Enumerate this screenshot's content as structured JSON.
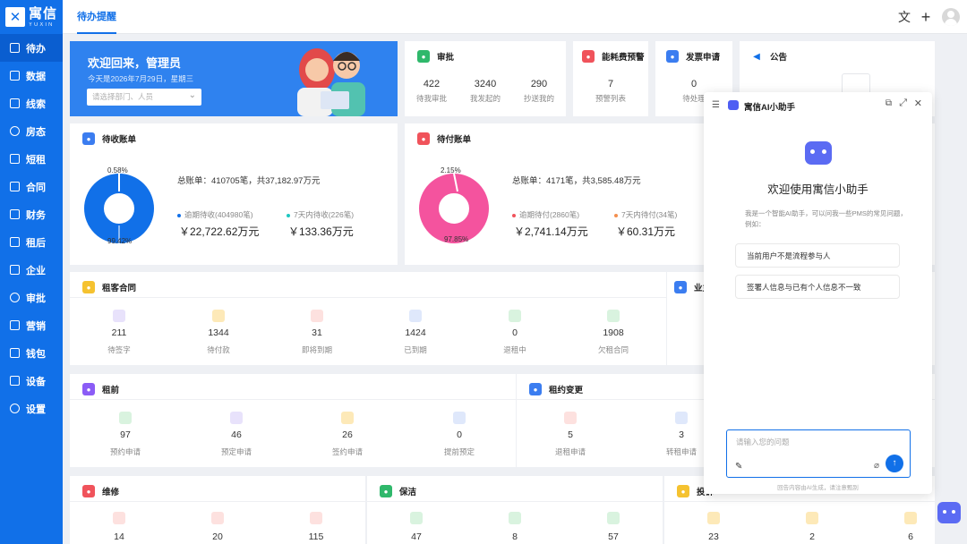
{
  "brand": {
    "logo_cn": "寓信",
    "logo_en": "YUXIN"
  },
  "sidebar": {
    "items": [
      {
        "label": "待办",
        "active": true
      },
      {
        "label": "数据"
      },
      {
        "label": "线索"
      },
      {
        "label": "房态"
      },
      {
        "label": "短租"
      },
      {
        "label": "合同"
      },
      {
        "label": "财务"
      },
      {
        "label": "租后"
      },
      {
        "label": "企业"
      },
      {
        "label": "审批"
      },
      {
        "label": "营销"
      },
      {
        "label": "钱包"
      },
      {
        "label": "设备"
      },
      {
        "label": "设置"
      }
    ]
  },
  "topbar": {
    "tab": "待办提醒"
  },
  "welcome": {
    "title": "欢迎回来，管理员",
    "date": "今天是2026年7月29日，星期三",
    "select_placeholder": "请选择部门、人员"
  },
  "approval": {
    "title": "审批",
    "stats": [
      {
        "value": "422",
        "label": "待我审批"
      },
      {
        "value": "3240",
        "label": "我发起的"
      },
      {
        "value": "290",
        "label": "抄送我的"
      }
    ]
  },
  "energy": {
    "title": "能耗费预警",
    "value": "7",
    "label": "预警列表"
  },
  "invoice": {
    "title": "发票申请",
    "value": "0",
    "label": "待处理"
  },
  "notice": {
    "title": "公告"
  },
  "receivable": {
    "title": "待收账单",
    "total": "总账单：410705笔，共37,182.97万元",
    "overdue_label": "逾期待收(404980笔)",
    "overdue_value": "￥22,722.62万元",
    "week_label": "7天内待收(226笔)",
    "week_value": "￥133.36万元",
    "pct_small": "0.58%",
    "pct_big": "99.42%"
  },
  "payable": {
    "title": "待付账单",
    "total": "总账单：4171笔，共3,585.48万元",
    "overdue_label": "逾期待付(2860笔)",
    "overdue_value": "￥2,741.14万元",
    "week_label": "7天内待付(34笔)",
    "week_value": "￥60.31万元",
    "pct_small": "2.15%",
    "pct_big": "97.85%"
  },
  "right_axis": "500",
  "tenant_contract": {
    "title": "租客合同",
    "items": [
      {
        "value": "211",
        "label": "待签字"
      },
      {
        "value": "1344",
        "label": "待付款"
      },
      {
        "value": "31",
        "label": "即将到期"
      },
      {
        "value": "1424",
        "label": "已到期"
      },
      {
        "value": "0",
        "label": "退租中"
      },
      {
        "value": "1908",
        "label": "欠租合同"
      }
    ]
  },
  "owner_partial": "业主",
  "pre_rent": {
    "title": "租前",
    "items": [
      {
        "value": "97",
        "label": "预约申请"
      },
      {
        "value": "46",
        "label": "预定申请"
      },
      {
        "value": "26",
        "label": "签约申请"
      },
      {
        "value": "0",
        "label": "提前预定"
      }
    ]
  },
  "lease_change": {
    "title": "租约变更",
    "items": [
      {
        "value": "5",
        "label": "退租申请"
      },
      {
        "value": "3",
        "label": "转租申请"
      }
    ]
  },
  "repair": {
    "title": "维修",
    "items": [
      {
        "value": "14"
      },
      {
        "value": "20"
      },
      {
        "value": "115"
      }
    ]
  },
  "cleaning": {
    "title": "保洁",
    "items": [
      {
        "value": "47"
      },
      {
        "value": "8"
      },
      {
        "value": "57"
      }
    ]
  },
  "complaint": {
    "title": "投诉",
    "items": [
      {
        "value": "23"
      },
      {
        "value": "2"
      },
      {
        "value": "6"
      }
    ]
  },
  "assistant": {
    "title": "寓信AI小助手",
    "welcome": "欢迎使用寓信小助手",
    "desc": "我是一个智能AI助手，可以问我一些PMS的常见问题，例如：",
    "suggestions": [
      "当前用户不是流程参与人",
      "签署人信息与已有个人信息不一致"
    ],
    "input_placeholder": "请输入您的问题",
    "note": "回告内容由AI生成，请注意甄别"
  },
  "colors": {
    "primary": "#1170e8",
    "receivable_donut": "#1170e8",
    "payable_donut": "#f4539e"
  }
}
